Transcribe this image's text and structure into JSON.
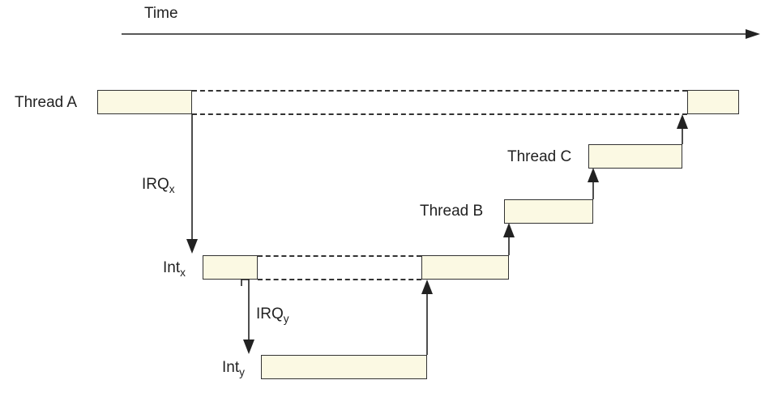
{
  "diagram": {
    "time_axis_label": "Time",
    "rows": {
      "thread_a": "Thread A",
      "int_x": "Int",
      "int_x_sub": "x",
      "int_y": "Int",
      "int_y_sub": "y",
      "thread_b": "Thread B",
      "thread_c": "Thread C"
    },
    "irq": {
      "x": "IRQ",
      "x_sub": "x",
      "y": "IRQ",
      "y_sub": "y"
    }
  }
}
